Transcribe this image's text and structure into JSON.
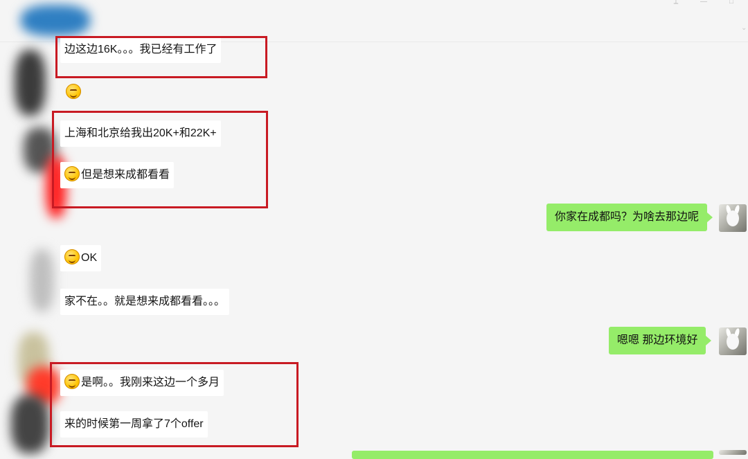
{
  "window_controls": {
    "pin": "⟂",
    "minimize": "—",
    "maximize": "□",
    "chevron": "⌄"
  },
  "incoming": [
    {
      "text": "边这边16K。。。我已经有工作了",
      "emoji": false
    },
    {
      "text": "上海和北京给我出20K+和22K+",
      "emoji": false
    },
    {
      "text": "但是想来成都看看",
      "emoji": true
    },
    {
      "text": "OK",
      "emoji": true
    },
    {
      "text": "家不在。。就是想来成都看看。。。",
      "emoji": false
    },
    {
      "text": "是啊。。我刚来这边一个多月",
      "emoji": true
    },
    {
      "text": "来的时候第一周拿了7个offer",
      "emoji": false
    }
  ],
  "outgoing": [
    {
      "text": "你家在成都吗？为啥去那边呢"
    },
    {
      "text": "嗯嗯  那边环境好"
    }
  ],
  "colors": {
    "background": "#f5f5f5",
    "incoming_bubble": "#ffffff",
    "outgoing_bubble": "#95ec69",
    "highlight": "#c81a23"
  },
  "icons": {
    "emoji": "smiley-emoji-icon",
    "avatar": "bunny-avatar-icon"
  }
}
